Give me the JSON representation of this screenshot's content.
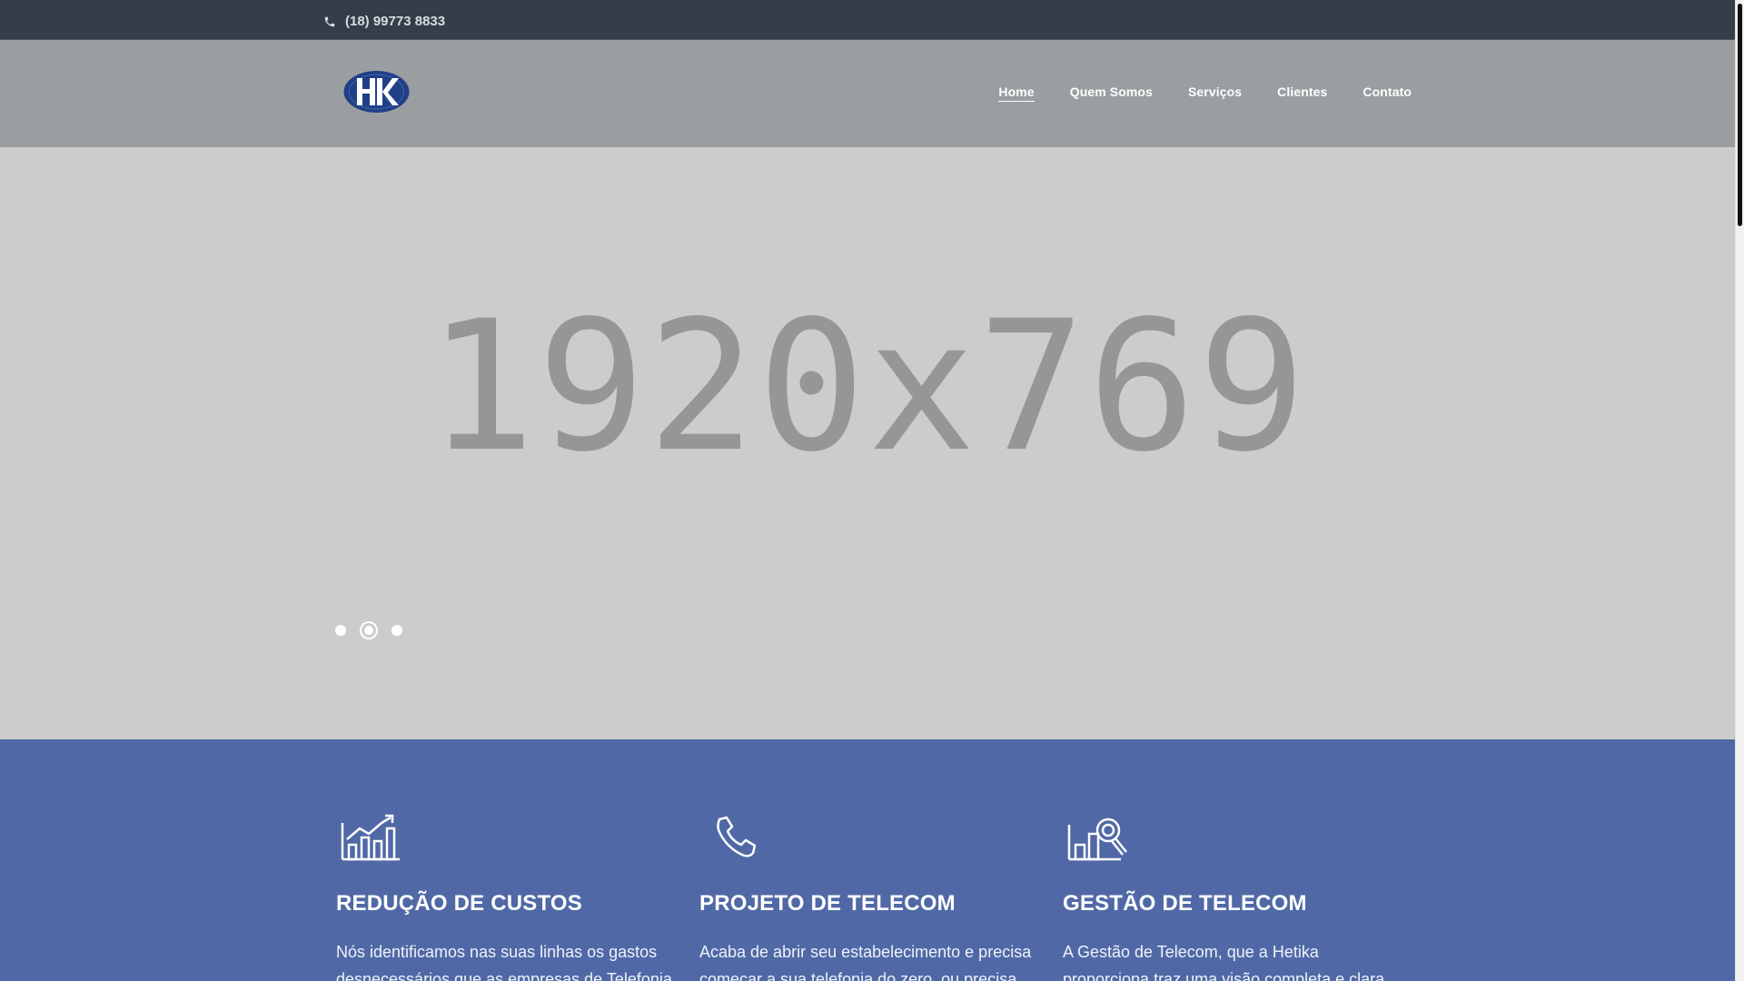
{
  "topbar": {
    "phone_icon": "phone-icon",
    "phone": "(18) 99773 8833"
  },
  "header": {
    "logo": {
      "text": "HK",
      "colors": {
        "outer": "#1f3f86",
        "inner": "#ffffff"
      }
    },
    "nav": [
      {
        "label": "Home",
        "active": true
      },
      {
        "label": "Quem Somos",
        "active": false
      },
      {
        "label": "Serviços",
        "active": false
      },
      {
        "label": "Clientes",
        "active": false
      },
      {
        "label": "Contato",
        "active": false
      }
    ]
  },
  "hero": {
    "placeholder_text": "1920x769",
    "slider": {
      "count": 3,
      "active_index": 1
    }
  },
  "features": [
    {
      "icon": "growth-chart-icon",
      "title": "REDUÇÃO DE CUSTOS",
      "text": "Nós identificamos nas suas linhas os gastos desnecessários que as empresas de Telefonia"
    },
    {
      "icon": "phone-handset-icon",
      "title": "PROJETO DE TELECOM",
      "text": "Acaba de abrir seu estabelecimento e precisa começar a sua telefonia do zero, ou precisa"
    },
    {
      "icon": "analytics-search-icon",
      "title": "GESTÃO DE TELECOM",
      "text": "A Gestão de Telecom, que a Hetika proporciona traz uma visão completa e clara"
    }
  ],
  "colors": {
    "topbar": "#333e49",
    "header": "#9a9ea1",
    "hero": "#cccccc",
    "features": "#5069a6"
  }
}
